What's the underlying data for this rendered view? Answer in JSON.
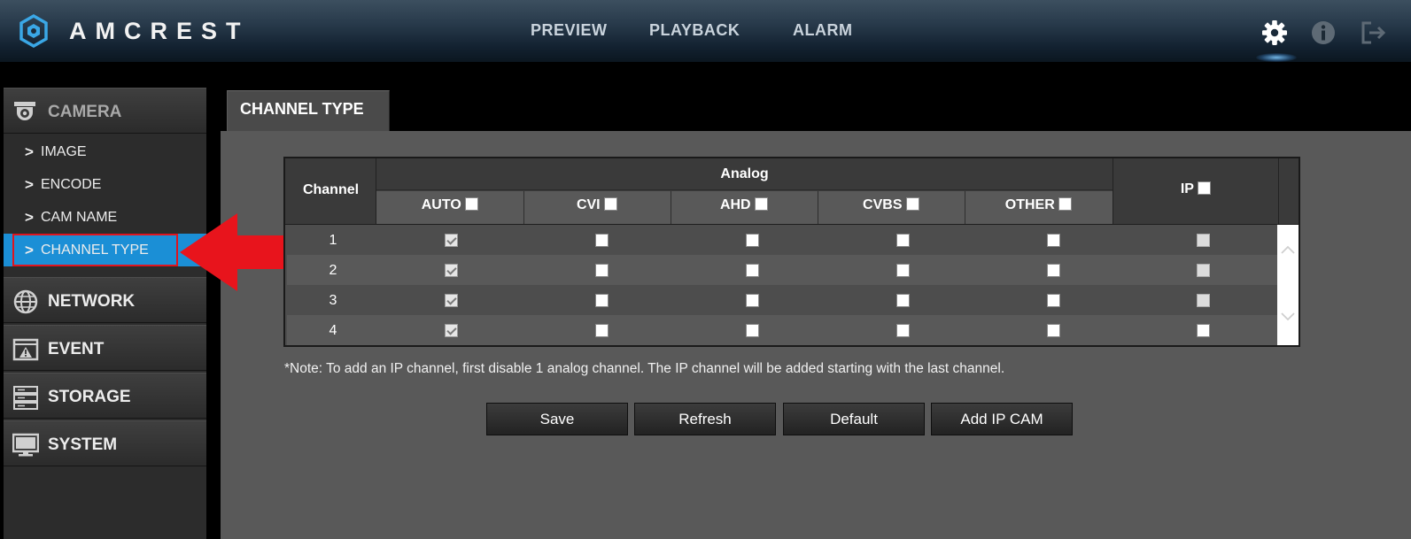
{
  "header": {
    "brand": "AMCREST",
    "nav": [
      "PREVIEW",
      "PLAYBACK",
      "ALARM"
    ],
    "icons": [
      "gear-icon",
      "info-icon",
      "logout-icon"
    ]
  },
  "sidebar": {
    "camera": {
      "label": "CAMERA",
      "items": [
        "IMAGE",
        "ENCODE",
        "CAM NAME",
        "CHANNEL TYPE"
      ],
      "active_item": "CHANNEL TYPE"
    },
    "categories": [
      "NETWORK",
      "EVENT",
      "STORAGE",
      "SYSTEM"
    ]
  },
  "tab": {
    "label": "CHANNEL TYPE"
  },
  "table": {
    "channel_header": "Channel",
    "analog_header": "Analog",
    "analog_columns": [
      "AUTO",
      "CVI",
      "AHD",
      "CVBS",
      "OTHER"
    ],
    "ip_column": "IP",
    "rows": [
      {
        "channel": "1",
        "auto": true,
        "cvi": false,
        "ahd": false,
        "cvbs": false,
        "other": false,
        "ip": false,
        "ip_disabled": true
      },
      {
        "channel": "2",
        "auto": true,
        "cvi": false,
        "ahd": false,
        "cvbs": false,
        "other": false,
        "ip": false,
        "ip_disabled": true
      },
      {
        "channel": "3",
        "auto": true,
        "cvi": false,
        "ahd": false,
        "cvbs": false,
        "other": false,
        "ip": false,
        "ip_disabled": true
      },
      {
        "channel": "4",
        "auto": true,
        "cvi": false,
        "ahd": false,
        "cvbs": false,
        "other": false,
        "ip": false,
        "ip_disabled": false
      }
    ]
  },
  "note": "*Note: To add an IP channel, first disable 1 analog channel. The IP channel will be added starting with the last channel.",
  "buttons": {
    "save": "Save",
    "refresh": "Refresh",
    "default": "Default",
    "add_ip_cam": "Add IP CAM"
  },
  "colors": {
    "accent": "#1b8fd6",
    "highlight_border": "#e0141e",
    "arrow": "#e8141c"
  }
}
